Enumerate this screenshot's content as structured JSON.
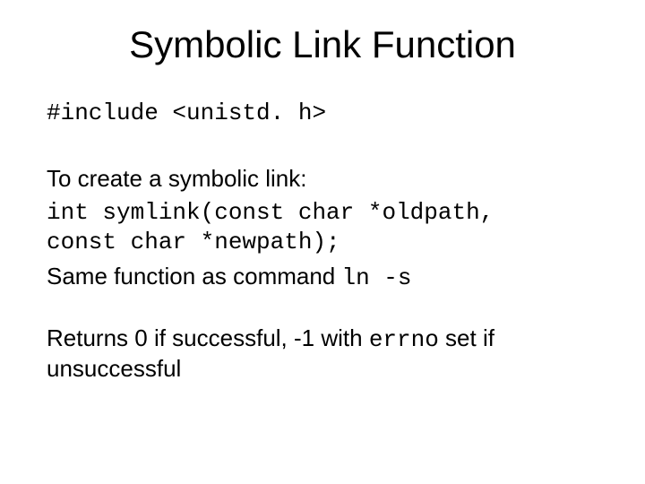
{
  "title": "Symbolic Link Function",
  "include_line": "#include <unistd. h>",
  "intro": "To create a symbolic link:",
  "proto_line1": "int symlink(const char *oldpath,",
  "proto_line2": "const char *newpath);",
  "same_prefix": "Same function as command ",
  "same_cmd": "ln -s",
  "returns_prefix": "Returns 0 if successful, -1 with ",
  "errno": "errno",
  "returns_suffix": " set if unsuccessful"
}
